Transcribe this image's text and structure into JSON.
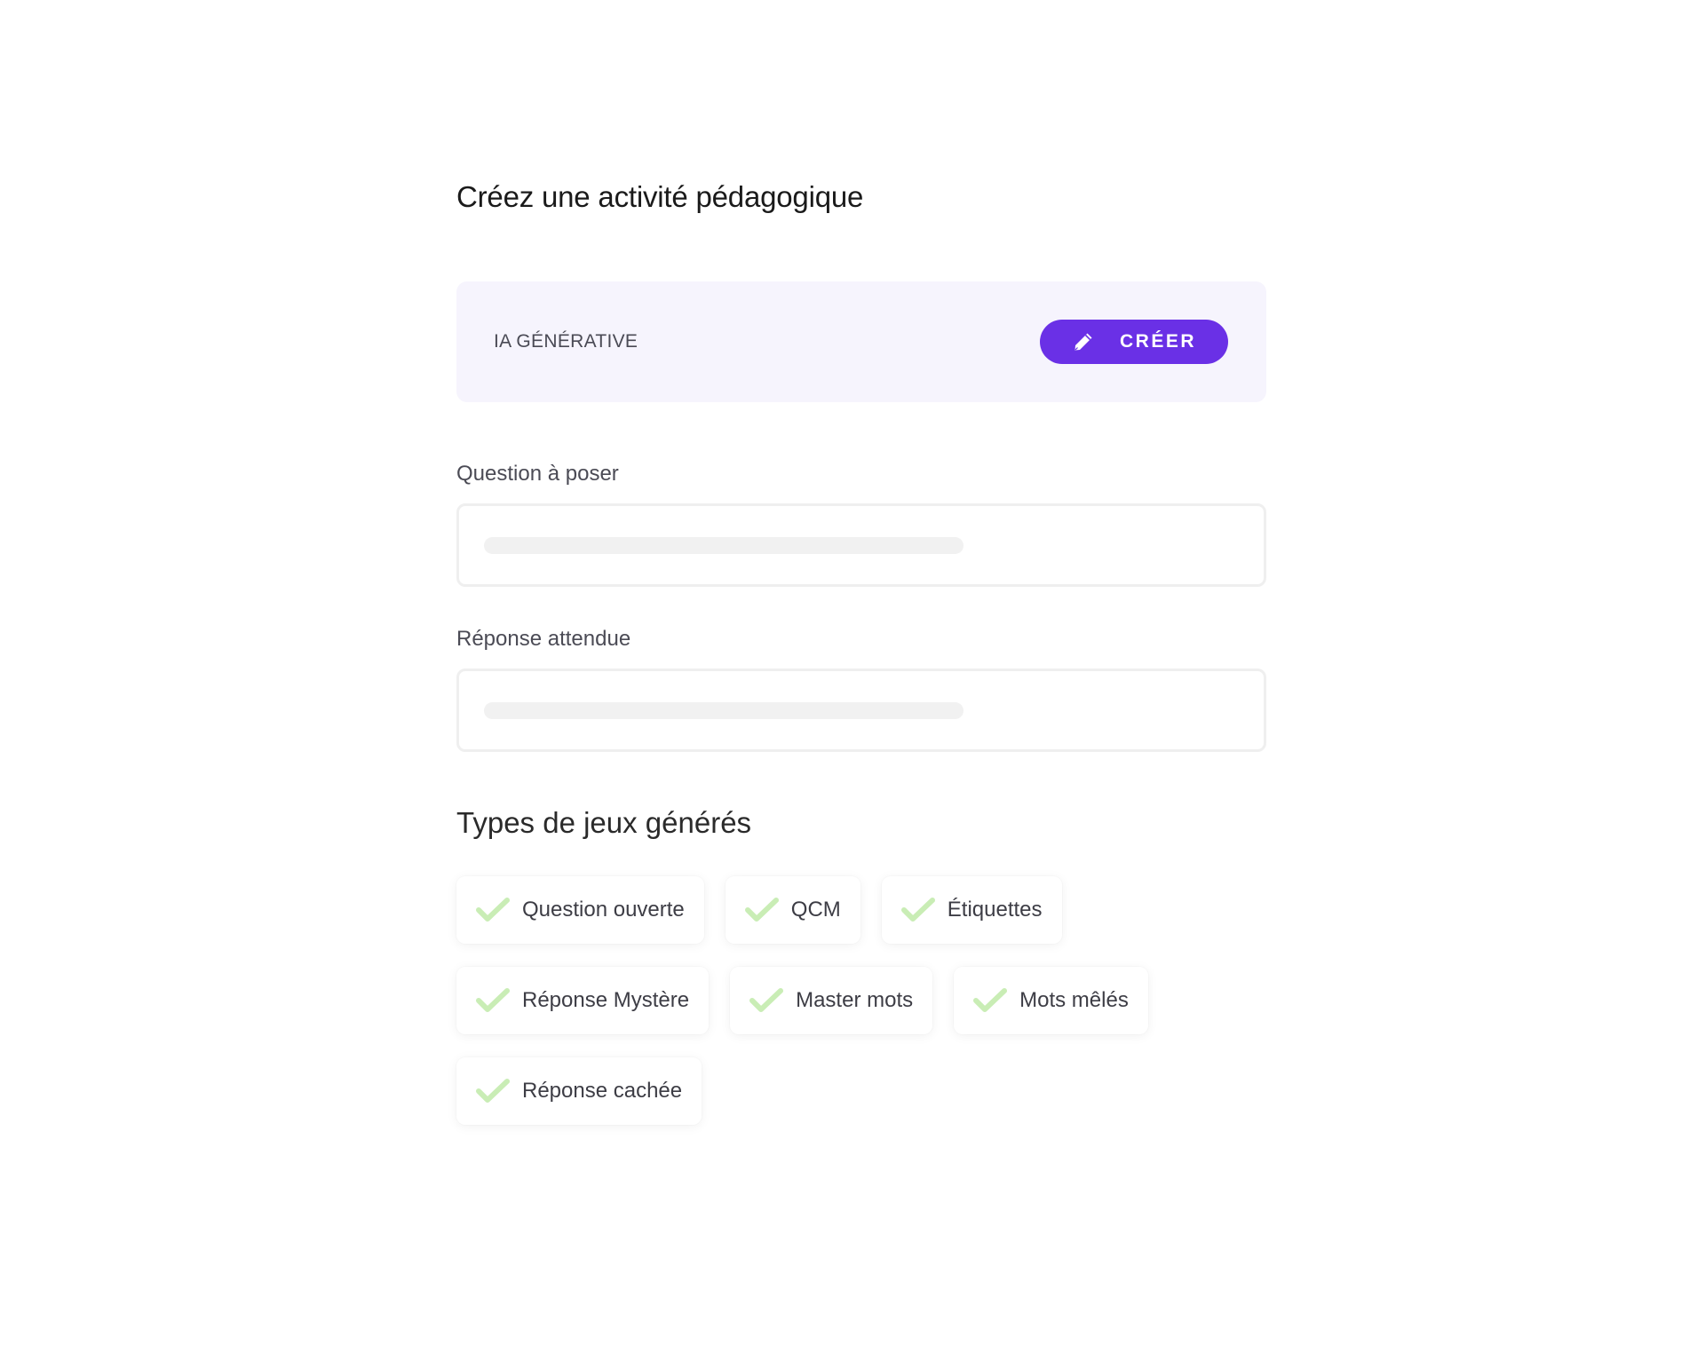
{
  "page": {
    "title": "Créez une activité pédagogique"
  },
  "ai_card": {
    "label": "IA GÉNÉRATIVE",
    "create_button_label": "CRÉER",
    "create_icon": "pencil-icon",
    "accent_color": "#6a30e6",
    "card_background": "#f6f4fd"
  },
  "fields": {
    "question": {
      "label": "Question à poser",
      "value": ""
    },
    "answer": {
      "label": "Réponse attendue",
      "value": ""
    }
  },
  "game_types": {
    "title": "Types de jeux générés",
    "check_icon": "check-icon",
    "check_color": "#c9edb5",
    "rows": [
      [
        {
          "label": "Question ouverte"
        },
        {
          "label": "QCM"
        },
        {
          "label": "Étiquettes"
        }
      ],
      [
        {
          "label": "Réponse Mystère"
        },
        {
          "label": "Master mots"
        },
        {
          "label": "Mots mêlés"
        }
      ],
      [
        {
          "label": "Réponse cachée"
        }
      ]
    ]
  }
}
